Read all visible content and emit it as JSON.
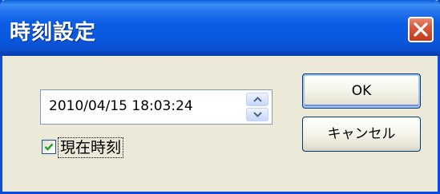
{
  "window": {
    "title": "時刻設定"
  },
  "titlebar": {
    "close_icon": "close-icon"
  },
  "datetime": {
    "value": "2010/04/15 18:03:24"
  },
  "current_time_checkbox": {
    "label": "現在時刻",
    "checked": true
  },
  "buttons": {
    "ok_label": "OK",
    "cancel_label": "キャンセル"
  },
  "colors": {
    "titlebar_blue": "#0a5bd8",
    "close_red": "#d9573a",
    "dialog_background": "#ece9d8"
  }
}
